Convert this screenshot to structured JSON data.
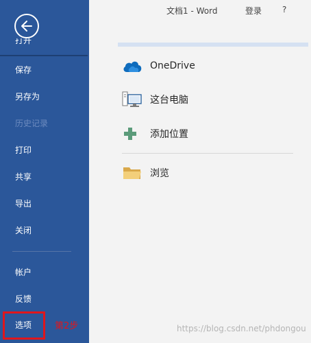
{
  "window": {
    "document_title": "文档1  -  Word",
    "signin_label": "登录",
    "help_label": "?"
  },
  "sidebar": {
    "back_icon": "arrow-left-circle-icon",
    "partial_item": "打开",
    "items": [
      {
        "label": "保存",
        "enabled": true
      },
      {
        "label": "另存为",
        "enabled": true
      },
      {
        "label": "历史记录",
        "enabled": false
      },
      {
        "label": "打印",
        "enabled": true
      },
      {
        "label": "共享",
        "enabled": true
      },
      {
        "label": "导出",
        "enabled": true
      },
      {
        "label": "关闭",
        "enabled": true
      },
      {
        "label": "帐户",
        "enabled": true
      },
      {
        "label": "反馈",
        "enabled": true
      },
      {
        "label": "选项",
        "enabled": true
      }
    ]
  },
  "annotation": {
    "step_label": "第2步",
    "highlight_color": "#e0161c"
  },
  "locations": [
    {
      "label": "OneDrive",
      "icon": "cloud-icon"
    },
    {
      "label": "这台电脑",
      "icon": "computer-icon"
    },
    {
      "label": "添加位置",
      "icon": "plus-icon"
    },
    {
      "label": "浏览",
      "icon": "folder-icon"
    }
  ],
  "watermark": "https://blog.csdn.net/phdongou",
  "colors": {
    "sidebar_bg": "#2b579a",
    "main_bg": "#f3f3f3",
    "accent_rule": "#d5e1f2"
  }
}
